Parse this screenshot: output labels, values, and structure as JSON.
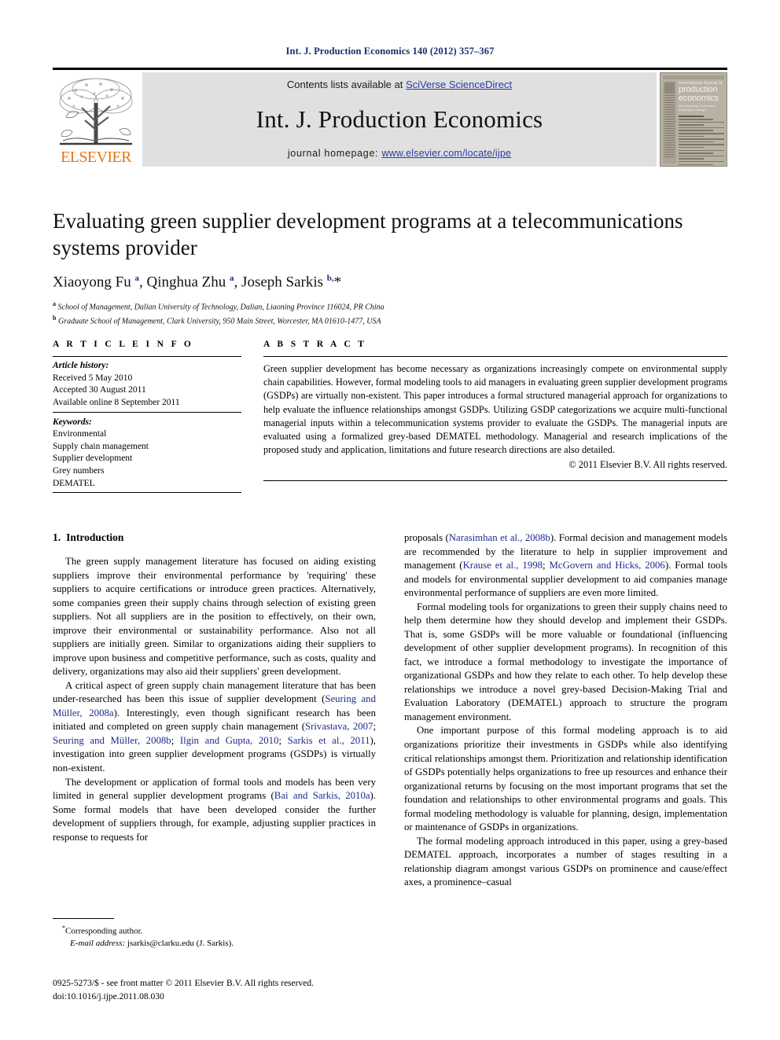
{
  "running_head": "Int. J. Production Economics 140 (2012) 357–367",
  "masthead": {
    "contents_prefix": "Contents lists available at ",
    "contents_link": "SciVerse ScienceDirect",
    "journal_title": "Int. J. Production Economics",
    "homepage_prefix": "journal homepage: ",
    "homepage_link": "www.elsevier.com/locate/ijpe",
    "publisher_name": "ELSEVIER",
    "publisher_color": "#e87511",
    "link_color": "#2a3ba8",
    "panel_color": "#e0e0e0",
    "cover": {
      "line1": "International Journal of",
      "line2": "production",
      "line3": "economics",
      "line4": "Manufacturing, Economics, Efficiency & Design"
    }
  },
  "article": {
    "title": "Evaluating green supplier development programs at a telecommunications systems provider",
    "authors_html": "Xiaoyong Fu <sup>a</sup>, Qinghua Zhu <sup>a</sup>, Joseph Sarkis <sup>b,</sup>*",
    "affiliation_a": "School of Management, Dalian University of Technology, Dalian, Liaoning Province 116024, PR China",
    "affiliation_b": "Graduate School of Management, Clark University, 950 Main Street, Worcester, MA 01610-1477, USA"
  },
  "article_info": {
    "heading": "A R T I C L E   I N F O",
    "history_label": "Article history:",
    "history": [
      "Received 5 May 2010",
      "Accepted 30 August 2011",
      "Available online 8 September 2011"
    ],
    "keywords_label": "Keywords:",
    "keywords": [
      "Environmental",
      "Supply chain management",
      "Supplier development",
      "Grey numbers",
      "DEMATEL"
    ]
  },
  "abstract": {
    "heading": "A B S T R A C T",
    "text": "Green supplier development has become necessary as organizations increasingly compete on environmental supply chain capabilities. However, formal modeling tools to aid managers in evaluating green supplier development programs (GSDPs) are virtually non-existent. This paper introduces a formal structured managerial approach for organizations to help evaluate the influence relationships amongst GSDPs. Utilizing GSDP categorizations we acquire multi-functional managerial inputs within a telecommunication systems provider to evaluate the GSDPs. The managerial inputs are evaluated using a formalized grey-based DEMATEL methodology. Managerial and research implications of the proposed study and application, limitations and future research directions are also detailed.",
    "copyright": "© 2011 Elsevier B.V. All rights reserved."
  },
  "body": {
    "section_number": "1.",
    "section_title": "Introduction",
    "left_paragraphs": [
      {
        "parts": [
          {
            "t": "The green supply management literature has focused on aiding existing suppliers improve their environmental performance by 'requiring' these suppliers to acquire certifications or introduce green practices. Alternatively, some companies green their supply chains through selection of existing green suppliers. Not all suppliers are in the position to effectively, on their own, improve their environmental or sustainability performance. Also not all suppliers are initially green. Similar to organizations aiding their suppliers to improve upon business and competitive performance, such as costs, quality and delivery, organizations may also aid their suppliers' green development."
          }
        ]
      },
      {
        "parts": [
          {
            "t": "A critical aspect of green supply chain management literature that has been under-researched has been this issue of supplier development ("
          },
          {
            "t": "Seuring and Müller, 2008a",
            "cite": true
          },
          {
            "t": "). Interestingly, even though significant research has been initiated and completed on green supply chain management ("
          },
          {
            "t": "Srivastava, 2007",
            "cite": true
          },
          {
            "t": "; "
          },
          {
            "t": "Seuring and Müller, 2008b",
            "cite": true
          },
          {
            "t": "; "
          },
          {
            "t": "Ilgin and Gupta, 2010",
            "cite": true
          },
          {
            "t": "; "
          },
          {
            "t": "Sarkis et al., 2011",
            "cite": true
          },
          {
            "t": "), investigation into green supplier development programs (GSDPs) is virtually non-existent."
          }
        ]
      },
      {
        "parts": [
          {
            "t": "The development or application of formal tools and models has been very limited in general supplier development programs ("
          },
          {
            "t": "Bai and Sarkis, 2010a",
            "cite": true
          },
          {
            "t": "). Some formal models that have been developed consider the further development of suppliers through, for example, adjusting supplier practices in response to requests for"
          }
        ]
      }
    ],
    "right_paragraphs": [
      {
        "first": true,
        "parts": [
          {
            "t": "proposals ("
          },
          {
            "t": "Narasimhan et al., 2008b",
            "cite": true
          },
          {
            "t": "). Formal decision and management models are recommended by the literature to help in supplier improvement and management ("
          },
          {
            "t": "Krause et al., 1998",
            "cite": true
          },
          {
            "t": "; "
          },
          {
            "t": "McGovern and Hicks, 2006",
            "cite": true
          },
          {
            "t": "). Formal tools and models for environmental supplier development to aid companies manage environmental performance of suppliers are even more limited."
          }
        ]
      },
      {
        "parts": [
          {
            "t": "Formal modeling tools for organizations to green their supply chains need to help them determine how they should develop and implement their GSDPs. That is, some GSDPs will be more valuable or foundational (influencing development of other supplier development programs). In recognition of this fact, we introduce a formal methodology to investigate the importance of organizational GSDPs and how they relate to each other. To help develop these relationships we introduce a novel grey-based Decision-Making Trial and Evaluation Laboratory (DEMATEL) approach to structure the program management environment."
          }
        ]
      },
      {
        "parts": [
          {
            "t": "One important purpose of this formal modeling approach is to aid organizations prioritize their investments in GSDPs while also identifying critical relationships amongst them. Prioritization and relationship identification of GSDPs potentially helps organizations to free up resources and enhance their organizational returns by focusing on the most important programs that set the foundation and relationships to other environmental programs and goals. This formal modeling methodology is valuable for planning, design, implementation or maintenance of GSDPs in organizations."
          }
        ]
      },
      {
        "parts": [
          {
            "t": "The formal modeling approach introduced in this paper, using a grey-based DEMATEL approach, incorporates a number of stages resulting in a relationship diagram amongst various GSDPs on prominence and cause/effect axes, a prominence–casual"
          }
        ]
      }
    ]
  },
  "footnotes": {
    "corresponding": "Corresponding author.",
    "email_label": "E-mail address:",
    "email_value": "jsarkis@clarku.edu (J. Sarkis)."
  },
  "imprint": {
    "line1": "0925-5273/$ - see front matter © 2011 Elsevier B.V. All rights reserved.",
    "line2": "doi:10.1016/j.ijpe.2011.08.030"
  }
}
